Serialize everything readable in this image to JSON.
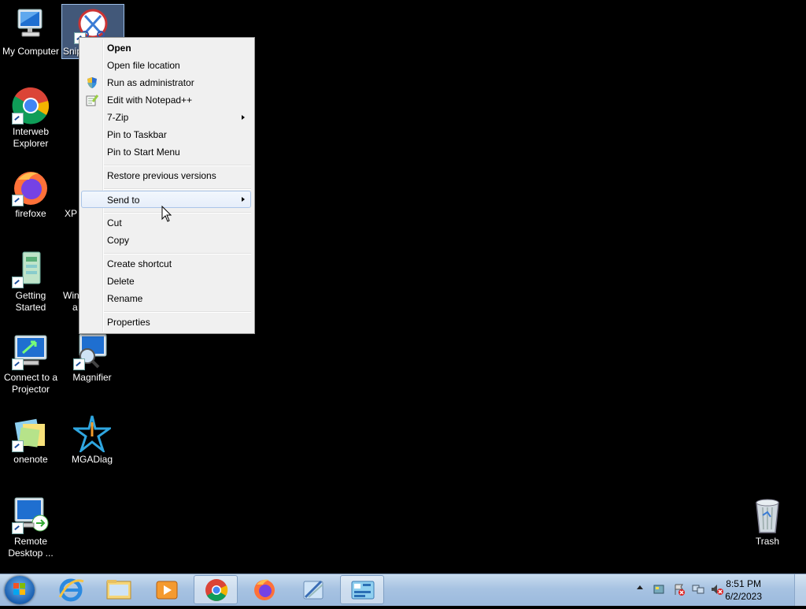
{
  "desktop": {
    "icons": [
      {
        "label": "My Computer"
      },
      {
        "label": "Snipping Tool"
      },
      {
        "label": "Interweb Explorer"
      },
      {
        "label": "firefoxe"
      },
      {
        "label": "XP"
      },
      {
        "label": "Getting Started"
      },
      {
        "label": "Windows Media Player"
      },
      {
        "label": "Connect to a Projector"
      },
      {
        "label": "Magnifier"
      },
      {
        "label": "onenote"
      },
      {
        "label": "MGADiag"
      },
      {
        "label": "Remote Desktop ..."
      },
      {
        "label": "Trash"
      }
    ],
    "icon_labels_display": {
      "my_computer": "My Computer",
      "snipping_partial": "Snip",
      "interweb": "Interweb Explorer",
      "firefoxe": "firefoxe",
      "xp_partial": "XP",
      "getting_started": "Getting Started",
      "wmp_partial_1": "Win",
      "wmp_partial_2": "a",
      "connect": "Connect to a Projector",
      "magnifier": "Magnifier",
      "onenote": "onenote",
      "mgadiag": "MGADiag",
      "remote": "Remote Desktop ...",
      "trash": "Trash"
    }
  },
  "context_menu": {
    "items": [
      {
        "label": "Open"
      },
      {
        "label": "Open file location"
      },
      {
        "label": "Run as administrator"
      },
      {
        "label": "Edit with Notepad++"
      },
      {
        "label": "7-Zip"
      },
      {
        "label": "Pin to Taskbar"
      },
      {
        "label": "Pin to Start Menu"
      },
      {
        "label": "Restore previous versions"
      },
      {
        "label": "Send to"
      },
      {
        "label": "Cut"
      },
      {
        "label": "Copy"
      },
      {
        "label": "Create shortcut"
      },
      {
        "label": "Delete"
      },
      {
        "label": "Rename"
      },
      {
        "label": "Properties"
      }
    ]
  },
  "taskbar": {
    "clock": {
      "time": "8:51 PM",
      "date": "6/2/2023"
    },
    "pinned": [
      "start-orb",
      "internet-explorer",
      "windows-explorer",
      "windows-media-player",
      "chrome",
      "firefox",
      "snipping-tool",
      "control-panel"
    ]
  },
  "colors": {
    "desktop_bg": "#000000",
    "menu_bg": "#f0f0f0",
    "menu_highlight": "#aac5e8",
    "taskbar": "#a7c3e2"
  }
}
